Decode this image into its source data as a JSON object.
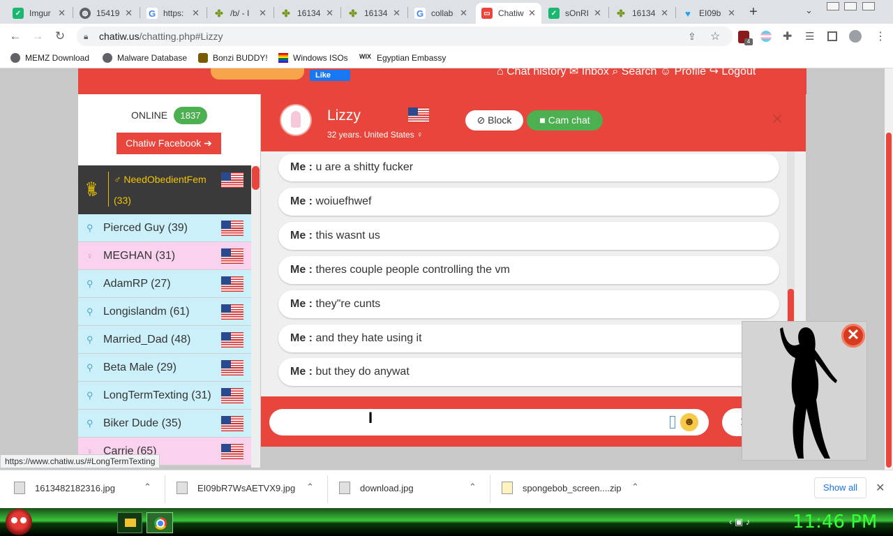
{
  "browser": {
    "tabs": [
      {
        "label": "Imgur",
        "favicon_color": "#1bb76e"
      },
      {
        "label": "15419",
        "favicon_color": "#5f6368"
      },
      {
        "label": "https:",
        "favicon_color": "#4285f4"
      },
      {
        "label": "/b/ - I",
        "favicon_color": "#789922"
      },
      {
        "label": "16134",
        "favicon_color": "#789922"
      },
      {
        "label": "16134",
        "favicon_color": "#789922"
      },
      {
        "label": "collab",
        "favicon_color": "#4285f4"
      },
      {
        "label": "Chatiw",
        "favicon_color": "#e8453c"
      },
      {
        "label": "sOnRI",
        "favicon_color": "#1bb76e"
      },
      {
        "label": "16134",
        "favicon_color": "#789922"
      },
      {
        "label": "EI09b",
        "favicon_color": "#1da1f2"
      }
    ],
    "url_host": "chatiw.us",
    "url_path": "/chatting.php#Lizzy",
    "extension_badge": "4",
    "bookmarks": [
      "MEMZ Download",
      "Malware Database",
      "Bonzi BUDDY!",
      "Windows ISOs",
      "Egyptian Embassy"
    ],
    "status_url": "https://www.chatiw.us/#LongTermTexting"
  },
  "site": {
    "nav": "⌂ Chat history  ✉ Inbox  ⌕ Search  ☺ Profile  ↪ Logout",
    "fb_like": "Like",
    "online_label": "ONLINE",
    "online_count": "1837",
    "facebook_button": "Chatiw Facebook ➔",
    "vip_badge": "VIP",
    "vip_user": {
      "name": "♂ NeedObedientFem",
      "age": "(33)"
    },
    "users": [
      {
        "name": "Pierced Guy (39)",
        "gender": "male"
      },
      {
        "name": "MEGHAN (31)",
        "gender": "female"
      },
      {
        "name": "AdamRP (27)",
        "gender": "male"
      },
      {
        "name": "Longislandm (61)",
        "gender": "male"
      },
      {
        "name": "Married_Dad (48)",
        "gender": "male"
      },
      {
        "name": "Beta Male (29)",
        "gender": "male"
      },
      {
        "name": "LongTermTexting (31)",
        "gender": "male"
      },
      {
        "name": "Biker Dude (35)",
        "gender": "male"
      },
      {
        "name": "Carrie (65)",
        "gender": "female"
      }
    ],
    "partner": {
      "name": "Lizzy",
      "info": "32 years. United States ♀"
    },
    "block_button": "⊘ Block",
    "cam_button": "■ Cam chat",
    "messages": [
      {
        "sender": "Me :",
        "text": " u are a shitty fucker"
      },
      {
        "sender": "Me :",
        "text": " woiuefhwef"
      },
      {
        "sender": "Me :",
        "text": " this wasnt us"
      },
      {
        "sender": "Me :",
        "text": " theres couple people controlling the vm"
      },
      {
        "sender": "Me :",
        "text": " they\"re cunts"
      },
      {
        "sender": "Me :",
        "text": " and they hate using it"
      },
      {
        "sender": "Me :",
        "text": " but they do anywat"
      }
    ],
    "input_value": "",
    "send_button": "➤ Send",
    "accent_color": "#e8453c"
  },
  "downloads": {
    "items": [
      "1613482182316.jpg",
      "EI09bR7WsAETVX9.jpg",
      "download.jpg",
      "spongebob_screen....zip"
    ],
    "show_all": "Show all"
  },
  "taskbar": {
    "clock": "11:46 PM",
    "tray": "‹  ▣  ♪"
  }
}
